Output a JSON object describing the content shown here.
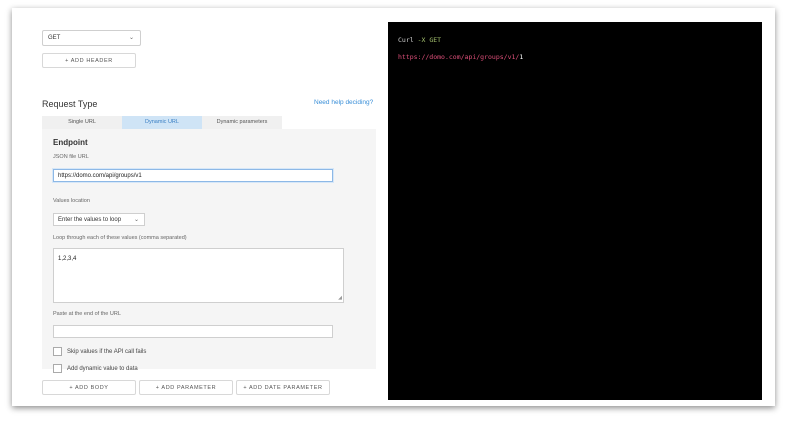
{
  "method": {
    "selected": "GET"
  },
  "add_header_label": "+ ADD HEADER",
  "request_type": {
    "title": "Request Type",
    "help_link": "Need help deciding?",
    "tabs": [
      {
        "label": "Single URL",
        "active": false
      },
      {
        "label": "Dynamic URL",
        "active": true
      },
      {
        "label": "Dynamic parameters",
        "active": false
      }
    ]
  },
  "endpoint": {
    "heading": "Endpoint",
    "json_file_url_label": "JSON file URL",
    "json_file_url_value": "https://domo.com/api/groups/v1",
    "values_location_label": "Values location",
    "values_location_selected": "Enter the values to loop",
    "loop_label": "Loop through each of these values (comma separated)",
    "loop_values": "1,2,3,4",
    "paste_end_label": "Paste at the end of the URL",
    "paste_end_value": "",
    "checkboxes": [
      {
        "label": "Skip values if the API call fails",
        "checked": false
      },
      {
        "label": "Add dynamic value to data",
        "checked": false
      }
    ]
  },
  "footer_buttons": {
    "add_body": "+ ADD BODY",
    "add_parameter": "+ ADD PARAMETER",
    "add_date_parameter": "+ ADD DATE PARAMETER"
  },
  "preview": {
    "curl_cmd": "Curl",
    "curl_flag": "-X GET",
    "url_text": "https://domo.com/api/groups/v1/",
    "cursor_text": "1"
  },
  "colors": {
    "accent_link": "#3a8fd8",
    "active_tab_bg": "#cfe4f6",
    "preview_bg": "#000000",
    "url_color": "#e0507b",
    "get_color": "#a6c36f"
  }
}
